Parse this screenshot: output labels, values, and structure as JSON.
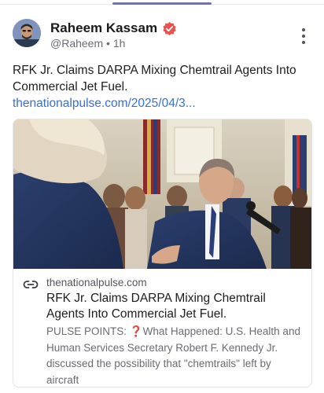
{
  "post": {
    "author_name": "Raheem Kassam",
    "handle": "@Raheem",
    "separator": "•",
    "time_ago": "1h",
    "text": "RFK Jr. Claims DARPA Mixing Chemtrail Agents Into Commercial Jet Fuel.",
    "link_text": "thenationalpulse.com/2025/04/3...",
    "more_icon": "more-vertical-icon",
    "verified_icon": "verified-badge-icon"
  },
  "link_card": {
    "domain": "thenationalpulse.com",
    "title": "RFK Jr. Claims DARPA Mixing Chemtrail Agents Into Commercial Jet Fuel.",
    "description": "PULSE POINTS: ❓What Happened: U.S. Health and Human Services Secretary Robert F. Kennedy Jr. discussed the possibility that \"chemtrails\" left by aircraft",
    "link_icon": "link-icon"
  },
  "colors": {
    "accent": "#6f6fc8",
    "link": "#3b6fcf",
    "verified": "#e8524f"
  }
}
